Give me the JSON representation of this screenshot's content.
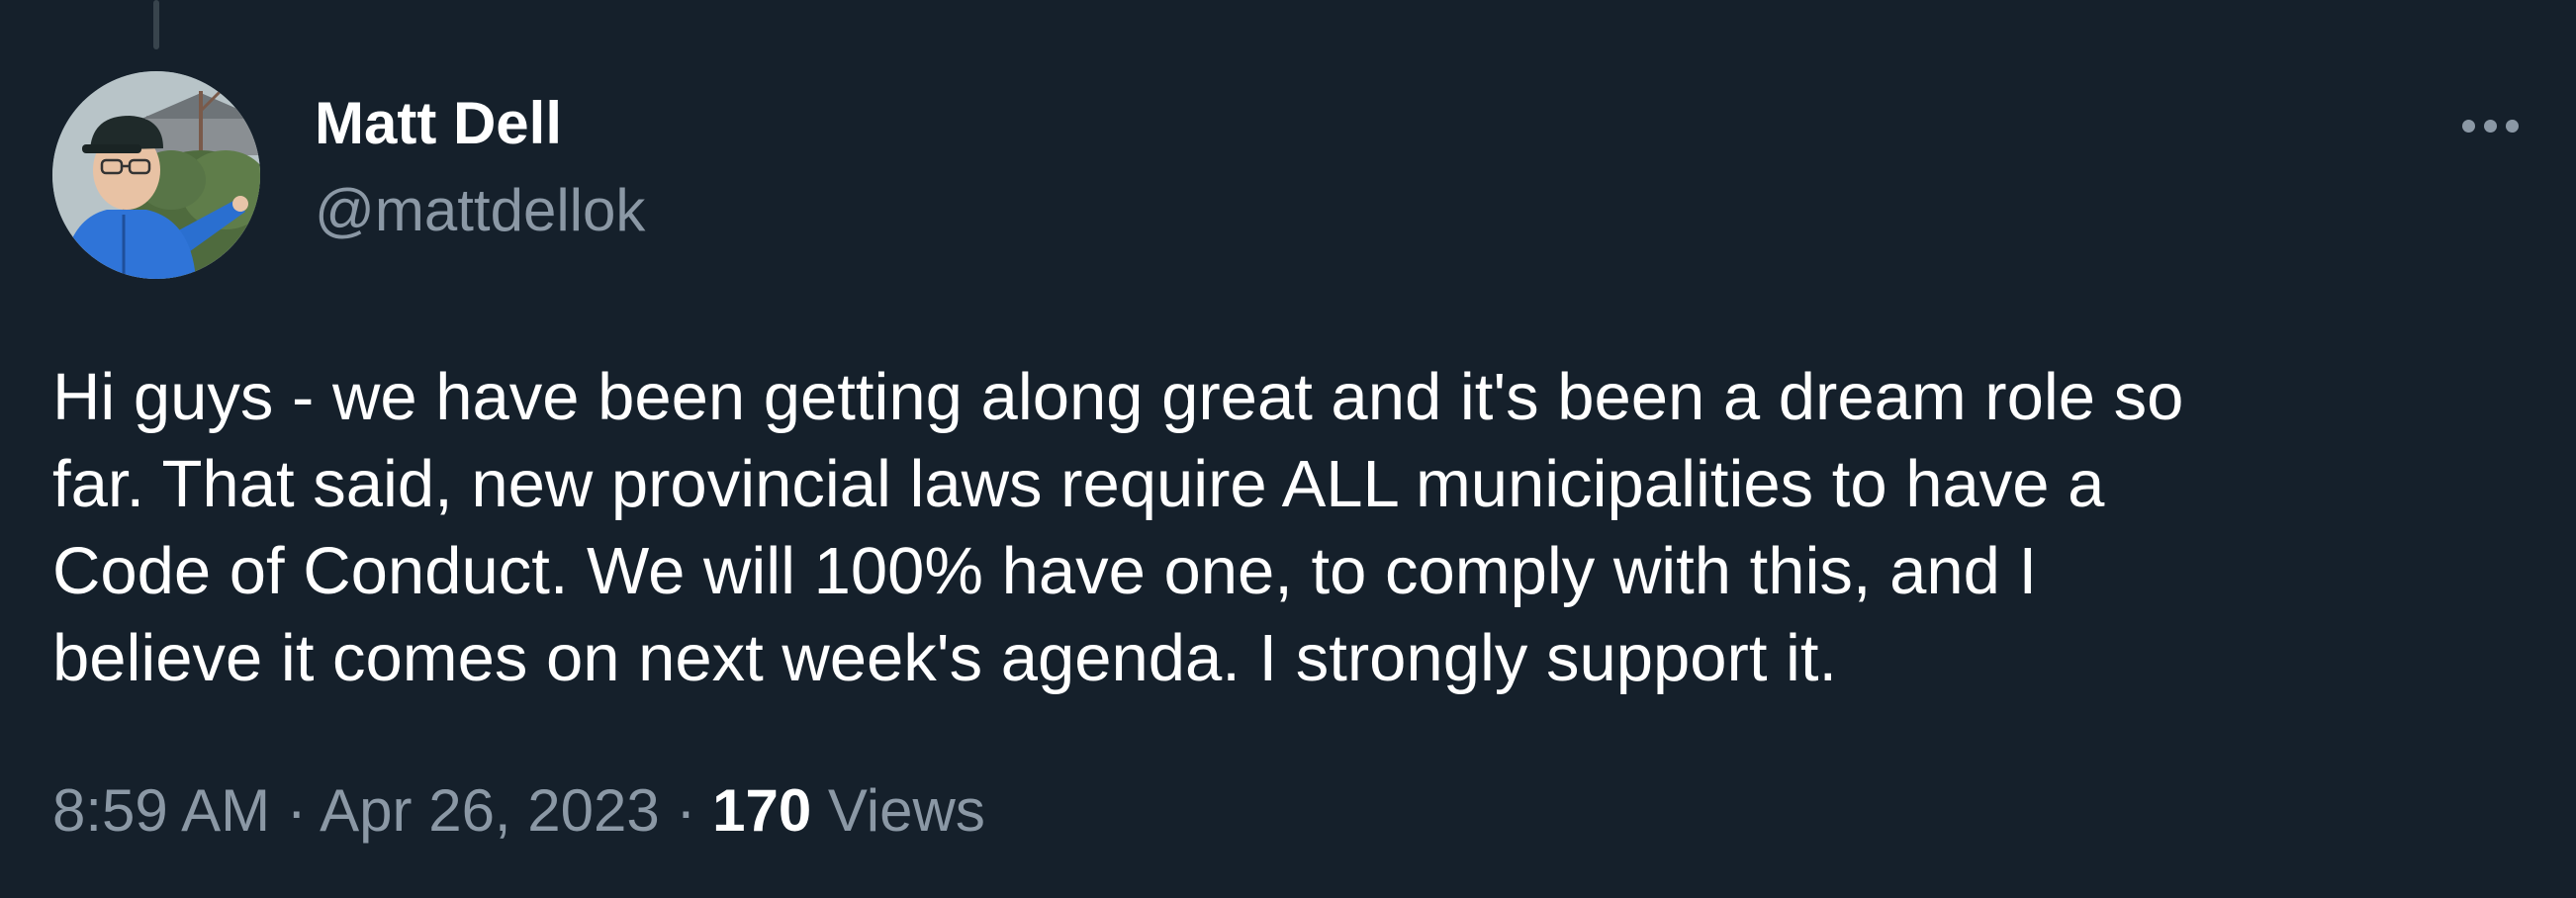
{
  "author": {
    "name": "Matt Dell",
    "handle": "@mattdellok"
  },
  "tweet": {
    "text_lines": [
      "Hi guys - we have been getting along great and it's been a dream role so",
      "far. That said, new provincial laws require ALL municipalities to have a",
      "Code of Conduct. We will 100% have one, to comply with this, and I",
      "believe it comes on next week's agenda. I strongly support it."
    ]
  },
  "meta": {
    "time": "8:59 AM",
    "separator": " · ",
    "date": "Apr 26, 2023",
    "views_count": "170",
    "views_label": " Views"
  },
  "icons": {
    "more": "more-horizontal-icon"
  },
  "colors": {
    "background": "#15202b",
    "primary_text": "#ffffff",
    "secondary_text": "#8b98a5"
  }
}
